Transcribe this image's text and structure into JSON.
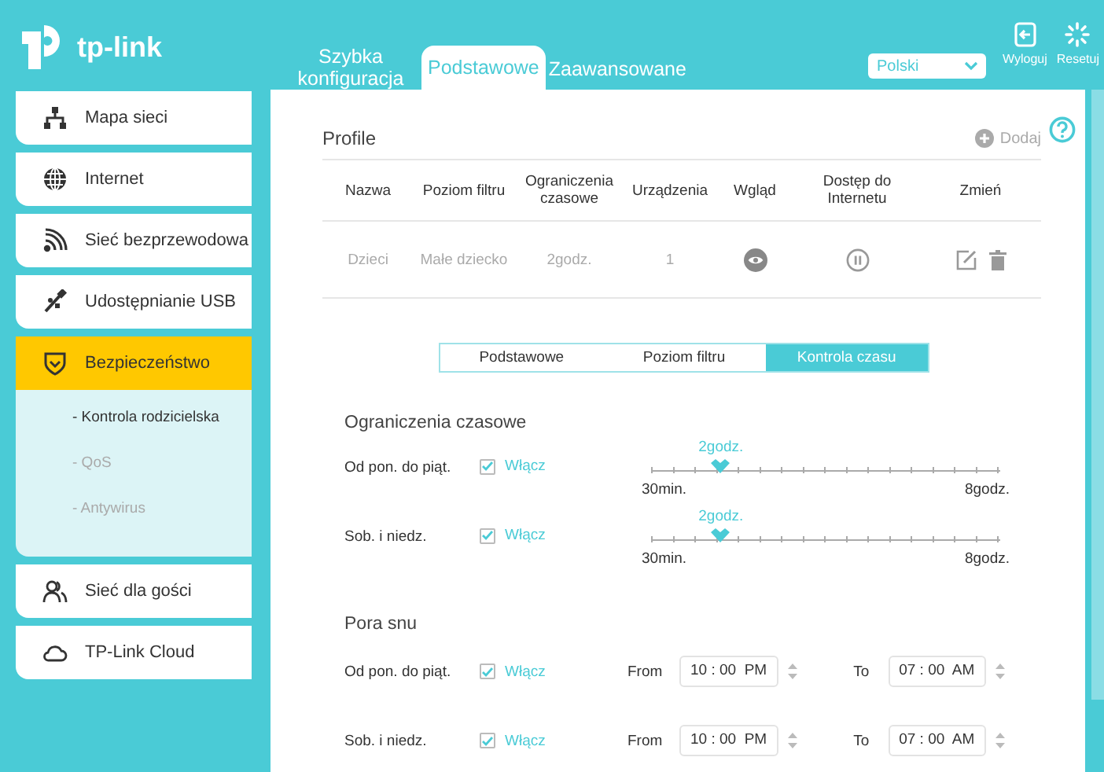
{
  "header": {
    "logo": "tp-link",
    "nav": [
      {
        "label": "Szybka konfiguracja",
        "selected": false
      },
      {
        "label": "Podstawowe",
        "selected": true
      },
      {
        "label": "Zaawansowane",
        "selected": false
      }
    ],
    "language": "Polski",
    "actions": [
      {
        "label": "Wyloguj",
        "kind": "logout"
      },
      {
        "label": "Resetuj",
        "kind": "reset"
      }
    ]
  },
  "sidebar": {
    "items": [
      {
        "label": "Mapa sieci",
        "selected": false
      },
      {
        "label": "Internet",
        "selected": false
      },
      {
        "label": "Sieć bezprzewodowa",
        "selected": false
      },
      {
        "label": "Udostępnianie USB",
        "selected": false
      },
      {
        "label": "Bezpieczeństwo",
        "selected": true,
        "children": [
          {
            "label": "- Kontrola rodzicielska",
            "selected": true
          },
          {
            "label": "- QoS",
            "selected": false
          },
          {
            "label": "- Antywirus",
            "selected": false
          }
        ]
      },
      {
        "label": "Sieć dla gości",
        "selected": false
      },
      {
        "label": "TP-Link Cloud",
        "selected": false
      }
    ]
  },
  "profile": {
    "title": "Profile",
    "add": "Dodaj",
    "columns": [
      "Nazwa",
      "Poziom filtru",
      "Ograniczenia czasowe",
      "Urządzenia",
      "Wgląd",
      "Dostęp do Internetu",
      "Zmień"
    ],
    "rows": [
      {
        "cells": [
          "Dzieci",
          "Małe dziecko",
          "2godz.",
          "1"
        ]
      }
    ]
  },
  "subtabs": [
    {
      "label": "Podstawowe",
      "selected": false
    },
    {
      "label": "Poziom filtru",
      "selected": false
    },
    {
      "label": "Kontrola czasu",
      "selected": true
    }
  ],
  "time_limits": {
    "title": "Ograniczenia czasowe",
    "rows": [
      {
        "label": "Od pon. do piąt.",
        "checked": true,
        "enable": "Włącz",
        "value": "2godz.",
        "level": 0.2,
        "min": "30min.",
        "max": "8godz."
      },
      {
        "label": "Sob. i niedz.",
        "checked": true,
        "enable": "Włącz",
        "value": "2godz.",
        "level": 0.2,
        "min": "30min.",
        "max": "8godz."
      }
    ]
  },
  "bedtime": {
    "title": "Pora snu",
    "rows": [
      {
        "label": "Od pon. do piąt.",
        "checked": true,
        "enable": "Włącz",
        "from_label": "From",
        "from": "10 : 00  PM",
        "to_label": "To",
        "to": "07 : 00  AM"
      },
      {
        "label": "Sob. i niedz.",
        "checked": true,
        "enable": "Włącz",
        "from_label": "From",
        "from": "10 : 00  PM",
        "to_label": "To",
        "to": "07 : 00  AM"
      }
    ]
  }
}
